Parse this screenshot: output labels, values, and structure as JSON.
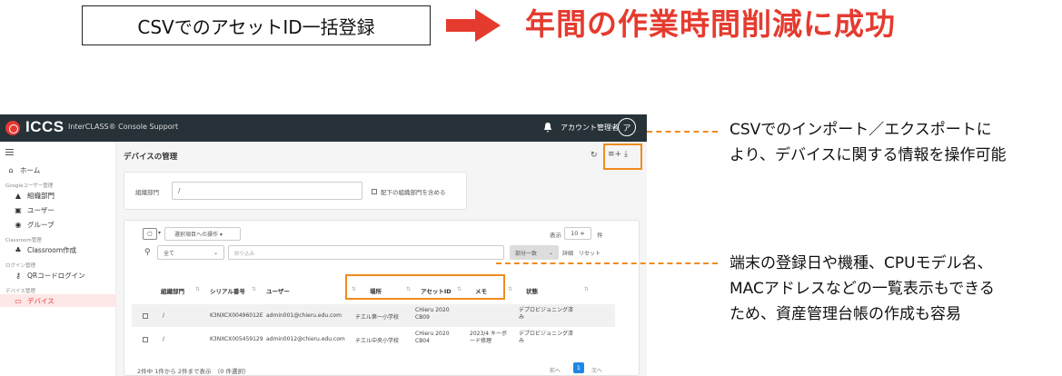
{
  "hero": {
    "box_text": "CSVでのアセットID一括登録",
    "headline": "年間の作業時間削減に成功"
  },
  "colors": {
    "accent": "#e53b2f",
    "highlight": "#f08c1e",
    "topbar": "#263238",
    "active_bg": "#fde7e7",
    "pager": "#1e88e5"
  },
  "app": {
    "brand": "ICCS",
    "brand_sub": "InterCLASS® Console Support",
    "account": "アカウント管理者",
    "avatar": "ア",
    "sidebar": {
      "home": "ホーム",
      "group_google": "Googleユーザー管理",
      "org": "組織部門",
      "users": "ユーザー",
      "groups": "グループ",
      "group_classroom": "Classroom管理",
      "classroom": "Classroom作成",
      "group_login": "ログイン管理",
      "qr": "QRコードログイン",
      "group_device": "デバイス管理",
      "device": "デバイス"
    },
    "main": {
      "title": "デバイスの管理",
      "filter": {
        "label": "組織部門",
        "value": "/",
        "checkbox": "配下の組織部門を含める"
      },
      "toolbar": {
        "bulk": "選択項目への操作 ▾",
        "display_label": "表示",
        "display_count": "10 ≑",
        "display_unit": "件",
        "scope": "全て",
        "keyword_placeholder": "絞り込み",
        "match": "部分一致",
        "advanced": "詳細",
        "reset": "リセット"
      },
      "columns": [
        "組織部門",
        "シリアル番号",
        "ユーザー",
        "場所",
        "アセットID",
        "メモ",
        "状態"
      ],
      "rows": [
        {
          "org": "/",
          "serial": "K3NXCX00496012E",
          "user": "admin001@chieru.edu.com",
          "location": "チエル第一小学校",
          "asset": "CHieru 2020 CB09",
          "memo": "",
          "status": "デプロビジョニング済み"
        },
        {
          "org": "/",
          "serial": "K3NXCX005459129",
          "user": "admin0012@chieru.edu.com",
          "location": "チエル中央小学校",
          "asset": "CHieru 2020 CB04",
          "memo": "2023/4 キーボード修理",
          "status": "デプロビジョニング済み"
        }
      ],
      "footer": "2件中 1件から 2件まで表示　（0 件選択）",
      "pager": {
        "prev": "前へ",
        "current": "1",
        "next": "次へ"
      }
    }
  },
  "annotations": {
    "csv_line1": "CSVでのインポート／エクスポートに",
    "csv_line2": "より、デバイスに関する情報を操作可能",
    "list_line1": "端末の登録日や機種、CPUモデル名、",
    "list_line2": "MACアドレスなどの一覧表示もできる",
    "list_line3": "ため、資産管理台帳の作成も容易"
  }
}
